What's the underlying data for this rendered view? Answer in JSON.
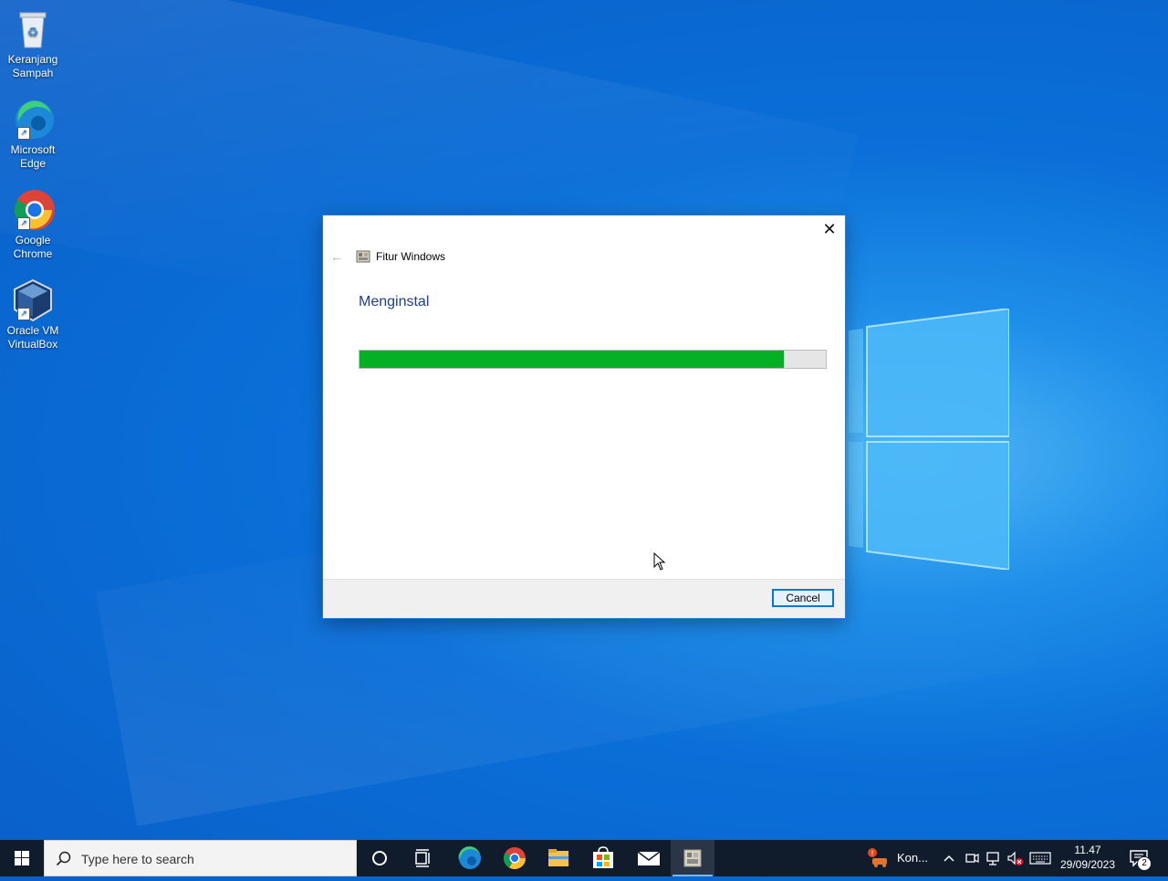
{
  "desktop": {
    "icons": [
      {
        "label_line1": "Keranjang",
        "label_line2": "Sampah",
        "icon": "recycle-bin-icon"
      },
      {
        "label_line1": "Microsoft",
        "label_line2": "Edge",
        "icon": "edge-icon"
      },
      {
        "label_line1": "Google",
        "label_line2": "Chrome",
        "icon": "chrome-icon"
      },
      {
        "label_line1": "Oracle VM",
        "label_line2": "VirtualBox",
        "icon": "virtualbox-icon"
      }
    ]
  },
  "dialog": {
    "app_title": "Fitur Windows",
    "heading": "Menginstal",
    "progress_percent": 91,
    "cancel_label": "Cancel",
    "close_glyph": "✕",
    "back_glyph": "←"
  },
  "taskbar": {
    "search_placeholder": "Type here to search",
    "tray_app_label": "Kon...",
    "time": "11.47",
    "date": "29/09/2023",
    "notification_count": "2"
  },
  "colors": {
    "progress_fill": "#06b025",
    "heading": "#1f3f86",
    "accent": "#0078d7"
  }
}
